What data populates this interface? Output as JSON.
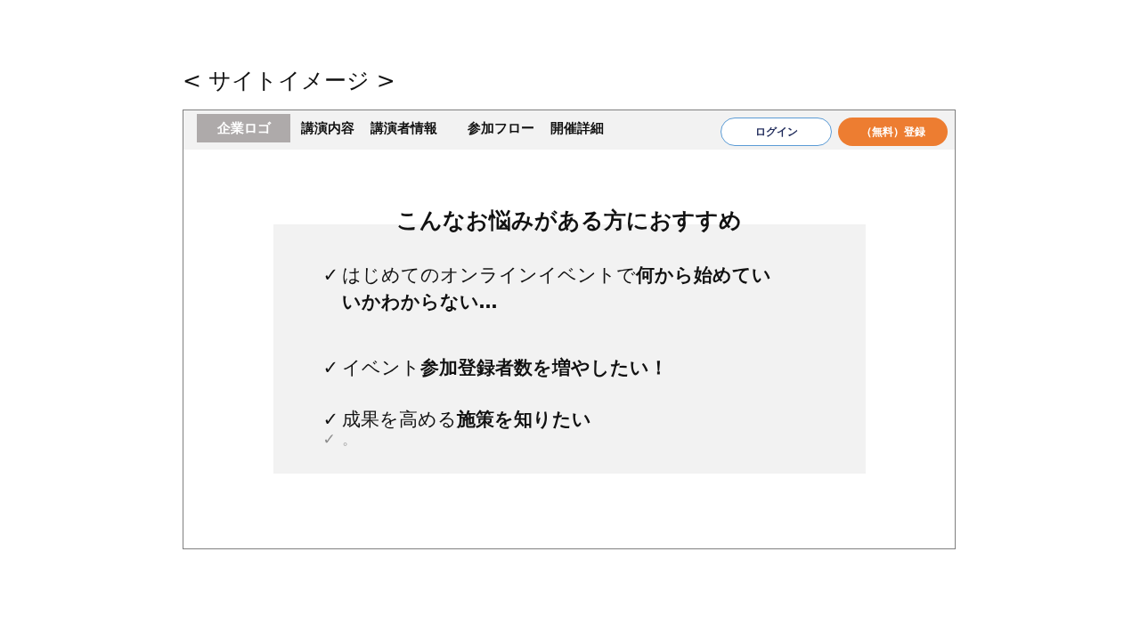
{
  "slide_title": "< サイトイメージ >",
  "header": {
    "logo": "企業ロゴ",
    "nav": [
      "講演内容",
      "講演者情報",
      "参加フロー",
      "開催詳細"
    ],
    "buttons": [
      {
        "label": "ログイン",
        "kind": "outline"
      },
      {
        "label": "（無料）登録",
        "kind": "primary"
      }
    ]
  },
  "section": {
    "heading": "こんなお悩みがある方におすすめ",
    "items": [
      {
        "kind": "normal",
        "mark": "✓",
        "text": "はじめてのオンラインイベントで**何から始めていいかわからない…**"
      },
      {
        "kind": "normal",
        "mark": "✓",
        "text": "イベント**参加登録者数を増やしたい！**"
      },
      {
        "kind": "normal",
        "mark": "✓",
        "text": "成果を高める**施策を知りたい**"
      },
      {
        "kind": "faint",
        "mark": "✓",
        "text": "。"
      }
    ]
  }
}
